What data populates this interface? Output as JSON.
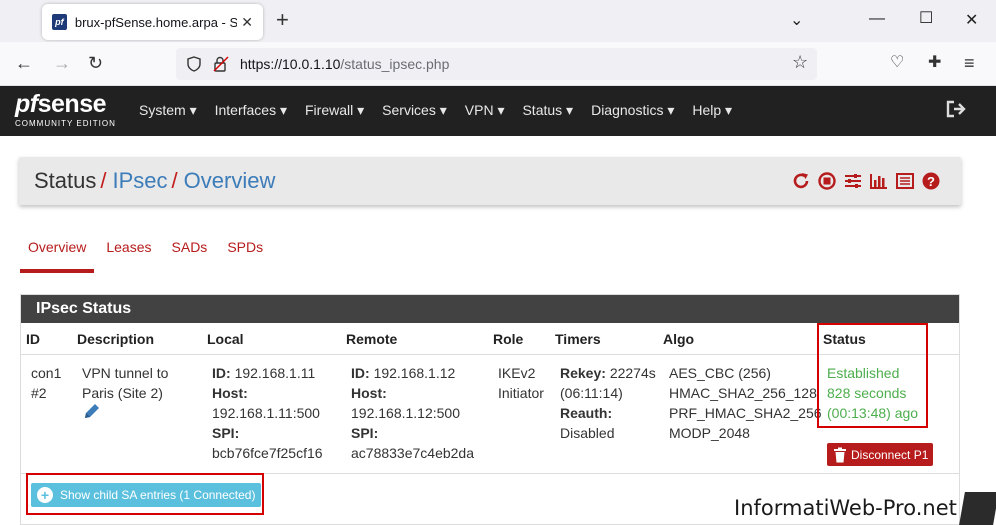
{
  "browser": {
    "tab_title": "brux-pfSense.home.arpa - Status: IPsec: Overview",
    "favicon_text": "pf",
    "url_host": "https://10.0.1.10",
    "url_path": "/status_ipsec.php"
  },
  "header": {
    "logo_pf": "pf",
    "logo_sense": "sense",
    "logo_sub": "COMMUNITY EDITION",
    "menu": [
      {
        "label": "System ▾"
      },
      {
        "label": "Interfaces ▾"
      },
      {
        "label": "Firewall ▾"
      },
      {
        "label": "Services ▾"
      },
      {
        "label": "VPN ▾"
      },
      {
        "label": "Status ▾"
      },
      {
        "label": "Diagnostics ▾"
      },
      {
        "label": "Help ▾"
      }
    ]
  },
  "breadcrumb": {
    "root": "Status",
    "level1": "IPsec",
    "level2": "Overview",
    "separator": "/"
  },
  "subtabs": [
    {
      "label": "Overview",
      "active": true
    },
    {
      "label": "Leases"
    },
    {
      "label": "SADs"
    },
    {
      "label": "SPDs"
    }
  ],
  "panel": {
    "title": "IPsec Status",
    "columns": [
      "ID",
      "Description",
      "Local",
      "Remote",
      "Role",
      "Timers",
      "Algo",
      "Status"
    ],
    "row": {
      "id": [
        "con1",
        "#2"
      ],
      "description": [
        "VPN tunnel to",
        "Paris (Site 2)"
      ],
      "local": {
        "id_label": "ID:",
        "id": "192.168.1.11",
        "host_label": "Host:",
        "host": "192.168.1.11:500",
        "spi_label": "SPI:",
        "spi": "bcb76fce7f25cf16"
      },
      "remote": {
        "id_label": "ID:",
        "id": "192.168.1.12",
        "host_label": "Host:",
        "host": "192.168.1.12:500",
        "spi_label": "SPI:",
        "spi": "ac78833e7c4eb2da"
      },
      "role": [
        "IKEv2",
        "Initiator"
      ],
      "timers": {
        "rekey_label": "Rekey:",
        "rekey": "22274s",
        "rekey_time": "(06:11:14)",
        "reauth_label": "Reauth:",
        "reauth": "Disabled"
      },
      "algo": [
        "AES_CBC (256)",
        "HMAC_SHA2_256_128",
        "PRF_HMAC_SHA2_256",
        "MODP_2048"
      ],
      "status": [
        "Established",
        "828 seconds",
        "(00:13:48) ago"
      ],
      "disconnect_label": "Disconnect P1"
    },
    "child_sa_label": "Show child SA entries (1 Connected)"
  },
  "watermark": "InformatiWeb-Pro.net",
  "colors": {
    "brand_red": "#b71c1c",
    "link_blue": "#3c7cb9",
    "status_green": "#4cae4c",
    "info_blue": "#5bc0de",
    "header_dark": "#212121",
    "panel_head": "#424242"
  }
}
